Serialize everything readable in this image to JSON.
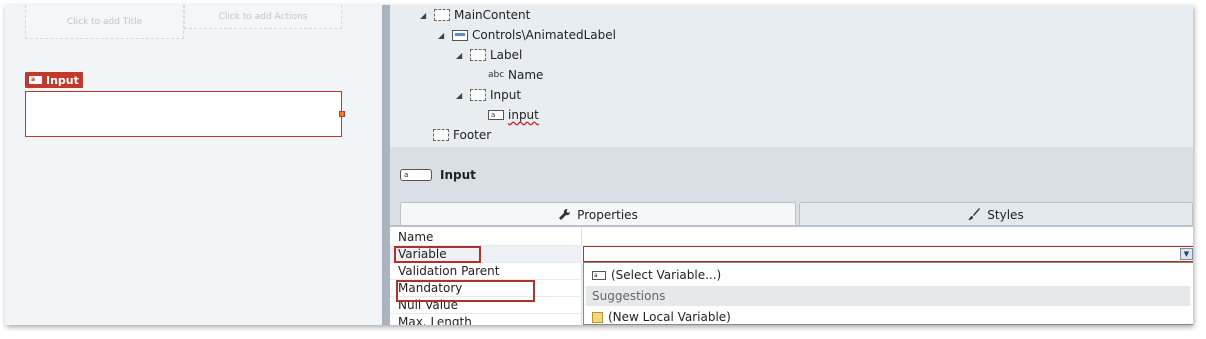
{
  "canvas": {
    "title_placeholder": "Click to add Title",
    "actions_placeholder": "Click to add Actions",
    "input_tag_label": "Input",
    "input_tag_icon": "a"
  },
  "tree": {
    "nodes": [
      {
        "label": "MainContent",
        "icon": "container-icon"
      },
      {
        "label": "Controls\\AnimatedLabel",
        "icon": "widget-icon"
      },
      {
        "label": "Label",
        "icon": "container-icon"
      },
      {
        "label": "Name",
        "icon": "expression-icon",
        "icon_text": "abc"
      },
      {
        "label": "Input",
        "icon": "container-icon"
      },
      {
        "label": "input",
        "icon": "input-icon",
        "icon_text": "a"
      },
      {
        "label": "Footer",
        "icon": "container-icon"
      }
    ]
  },
  "selected": {
    "icon_text": "a",
    "title": "Input"
  },
  "tabs": {
    "properties": "Properties",
    "styles": "Styles"
  },
  "properties": {
    "rows": [
      "Name",
      "Variable",
      "Validation Parent",
      "Mandatory",
      "Null Value",
      "Max. Length"
    ]
  },
  "dropdown": {
    "select_variable": "(Select Variable...)",
    "suggestions_header": "Suggestions",
    "new_local_variable": "(New Local Variable)"
  },
  "colors": {
    "highlight": "#b0302a",
    "canvas_bg": "#f2f5f8",
    "tree_bg": "#e8edf2"
  }
}
